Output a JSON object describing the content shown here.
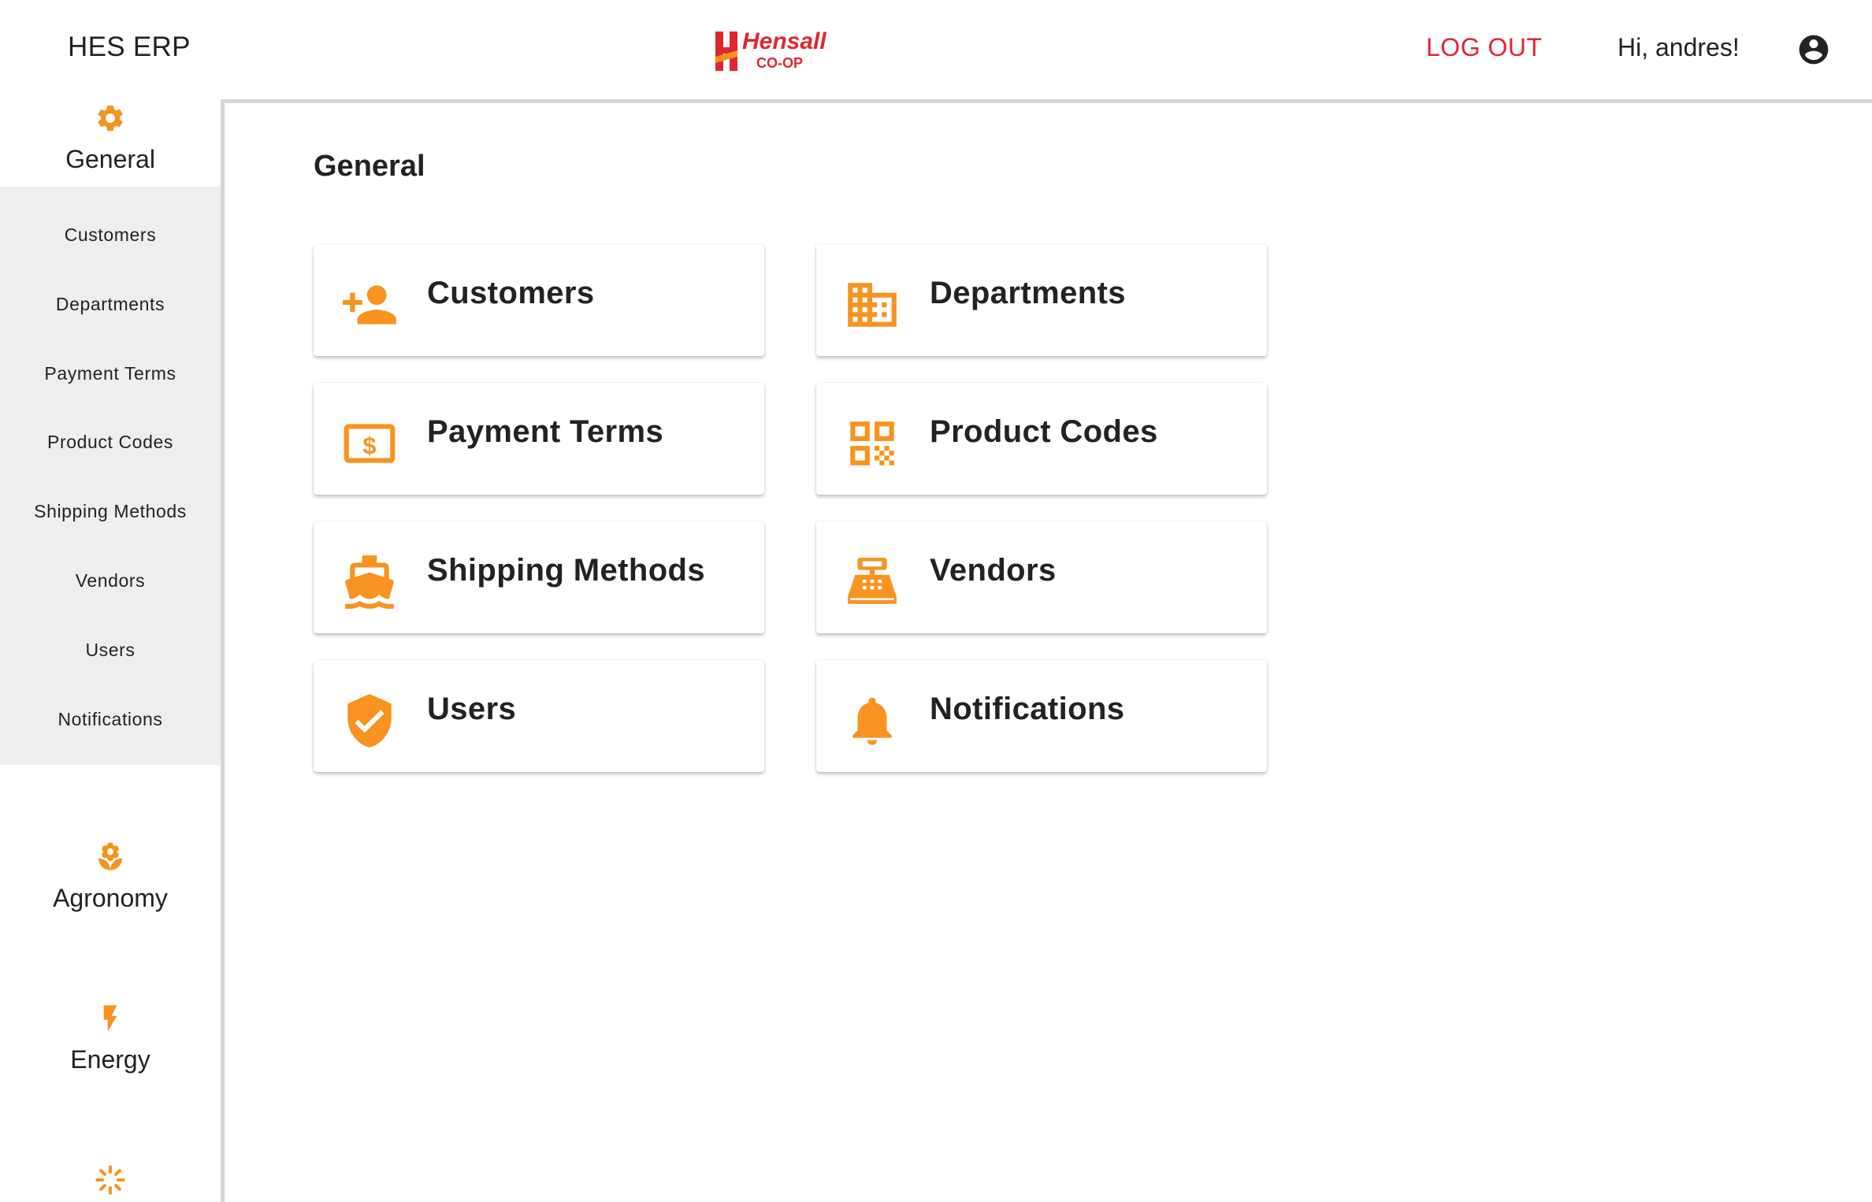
{
  "header": {
    "app_title": "HES ERP",
    "logo_text_main": "Hensall",
    "logo_text_sub": "CO-OP",
    "logout_label": "LOG OUT",
    "greeting": "Hi, andres!"
  },
  "colors": {
    "accent": "#f7931e",
    "logout": "#e0262f",
    "logo_red": "#e0262f",
    "submenu_bg": "#eeeeee"
  },
  "sidebar": {
    "sections": [
      {
        "label": "General",
        "icon": "gear-icon"
      },
      {
        "label": "Agronomy",
        "icon": "flower-icon"
      },
      {
        "label": "Energy",
        "icon": "bolt-icon"
      },
      {
        "label": "",
        "icon": "sparkle-icon"
      }
    ],
    "submenu": [
      "Customers",
      "Departments",
      "Payment Terms",
      "Product Codes",
      "Shipping Methods",
      "Vendors",
      "Users",
      "Notifications"
    ]
  },
  "main": {
    "title": "General",
    "cards": [
      {
        "label": "Customers",
        "icon": "add-person-icon"
      },
      {
        "label": "Departments",
        "icon": "building-icon"
      },
      {
        "label": "Payment Terms",
        "icon": "dollar-bill-icon"
      },
      {
        "label": "Product Codes",
        "icon": "qr-code-icon"
      },
      {
        "label": "Shipping Methods",
        "icon": "ship-icon"
      },
      {
        "label": "Vendors",
        "icon": "cash-register-icon"
      },
      {
        "label": "Users",
        "icon": "shield-check-icon"
      },
      {
        "label": "Notifications",
        "icon": "bell-icon"
      }
    ]
  }
}
